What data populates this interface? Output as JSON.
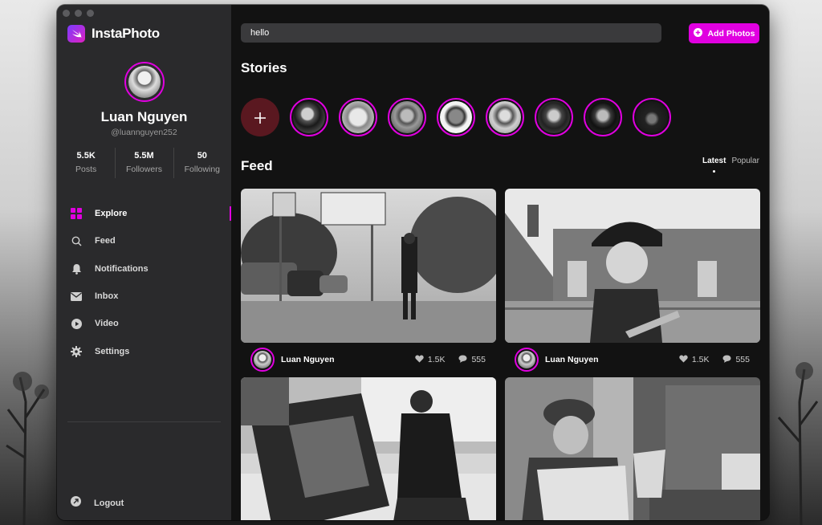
{
  "app": {
    "name": "InstaPhoto"
  },
  "profile": {
    "name": "Luan Nguyen",
    "handle": "@luannguyen252",
    "stats": [
      {
        "value": "5.5K",
        "label": "Posts"
      },
      {
        "value": "5.5M",
        "label": "Followers"
      },
      {
        "value": "50",
        "label": "Following"
      }
    ]
  },
  "nav": {
    "items": [
      {
        "label": "Explore",
        "icon": "grid-icon",
        "active": true
      },
      {
        "label": "Feed",
        "icon": "search-icon"
      },
      {
        "label": "Notifications",
        "icon": "bell-icon"
      },
      {
        "label": "Inbox",
        "icon": "mail-icon"
      },
      {
        "label": "Video",
        "icon": "play-icon"
      },
      {
        "label": "Settings",
        "icon": "gear-icon"
      }
    ],
    "logout_label": "Logout"
  },
  "search": {
    "value": "hello"
  },
  "add_photos_label": "Add Photos",
  "stories": {
    "title": "Stories"
  },
  "feed": {
    "title": "Feed",
    "tabs": [
      {
        "label": "Latest",
        "active": true
      },
      {
        "label": "Popular"
      }
    ],
    "posts": [
      {
        "user": "Luan Nguyen",
        "likes": "1.5K",
        "comments": "555"
      },
      {
        "user": "Luan Nguyen",
        "likes": "1.5K",
        "comments": "555"
      },
      {
        "user": "",
        "likes": "",
        "comments": ""
      },
      {
        "user": "",
        "likes": "",
        "comments": ""
      }
    ]
  },
  "colors": {
    "accent": "#e000e0",
    "sidebar": "#2a2a2c",
    "background": "#121212",
    "story_add": "#5a1820"
  }
}
